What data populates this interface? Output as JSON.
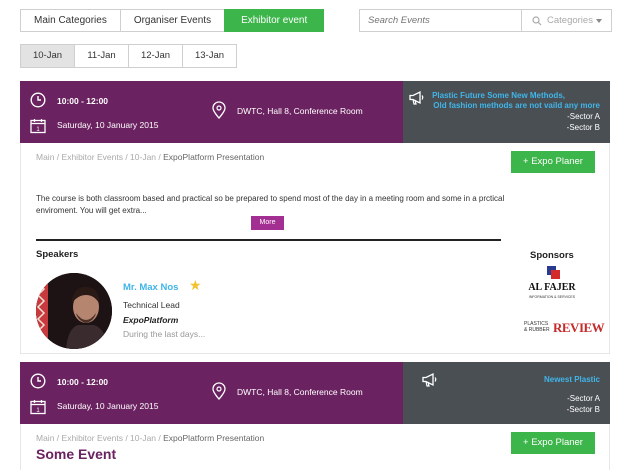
{
  "category_tabs": [
    {
      "label": "Main Categories",
      "active": false
    },
    {
      "label": "Organiser Events",
      "active": false
    },
    {
      "label": "Exhibitor event",
      "active": true
    }
  ],
  "search": {
    "placeholder": "Search Events",
    "category_label": "Categories"
  },
  "date_tabs": [
    {
      "label": "10-Jan",
      "active": true
    },
    {
      "label": "11-Jan",
      "active": false
    },
    {
      "label": "12-Jan",
      "active": false
    },
    {
      "label": "13-Jan",
      "active": false
    }
  ],
  "colors": {
    "accent_green": "#3cb54a",
    "header_purple": "#6b2260",
    "side_gray": "#4a4f54",
    "link_blue": "#40b5e8",
    "more_purple": "#a42f92"
  },
  "events": [
    {
      "time": "10:00 - 12:00",
      "date": "Saturday, 10 January 2015",
      "location": "DWTC, Hall 8, Conference Room",
      "side_title_line1": "Plastic Future Some New Methods,",
      "side_title_line2": "Old fashion methods are not vaild any more",
      "sector_a": "-Sector A",
      "sector_b": "-Sector B",
      "breadcrumb": {
        "main": "Main",
        "sep1": " / ",
        "exhibitor_events": "Exhibitor Events",
        "sep2": " / ",
        "day": "10-Jan",
        "sep3": " / ",
        "current": "ExpoPlatform Presentation"
      },
      "expo_button": "+ Expo Planer",
      "description": "The course is both classroom based and practical so be prepared to spend most of the day in a meeting room and some in a prctical enviroment. You will get extra...",
      "more_button": "More",
      "speakers_heading": "Speakers",
      "sponsors_heading": "Sponsors",
      "speaker": {
        "name": "Mr. Max Nos",
        "role": "Technical Lead",
        "organisation": "ExpoPlatform",
        "bio": "During the last days..."
      },
      "sponsors": [
        {
          "name": "AL FAJER",
          "tagline": "INFORMATION & SERVICES"
        },
        {
          "name_small_1": "PLASTICS",
          "name_small_2": "& RUBBER",
          "name_big": "REVIEW"
        }
      ]
    },
    {
      "time": "10:00 - 12:00",
      "date": "Saturday, 10 January 2015",
      "location": "DWTC, Hall 8, Conference Room",
      "side_title_line1": "Newest Plastic",
      "sector_a": "-Sector A",
      "sector_b": "-Sector B",
      "breadcrumb": {
        "main": "Main",
        "sep1": " / ",
        "exhibitor_events": "Exhibitor Events",
        "sep2": " / ",
        "day": "10-Jan",
        "sep3": " / ",
        "current": "ExpoPlatform Presentation"
      },
      "expo_button": "+ Expo Planer",
      "title": "Some Event"
    }
  ]
}
